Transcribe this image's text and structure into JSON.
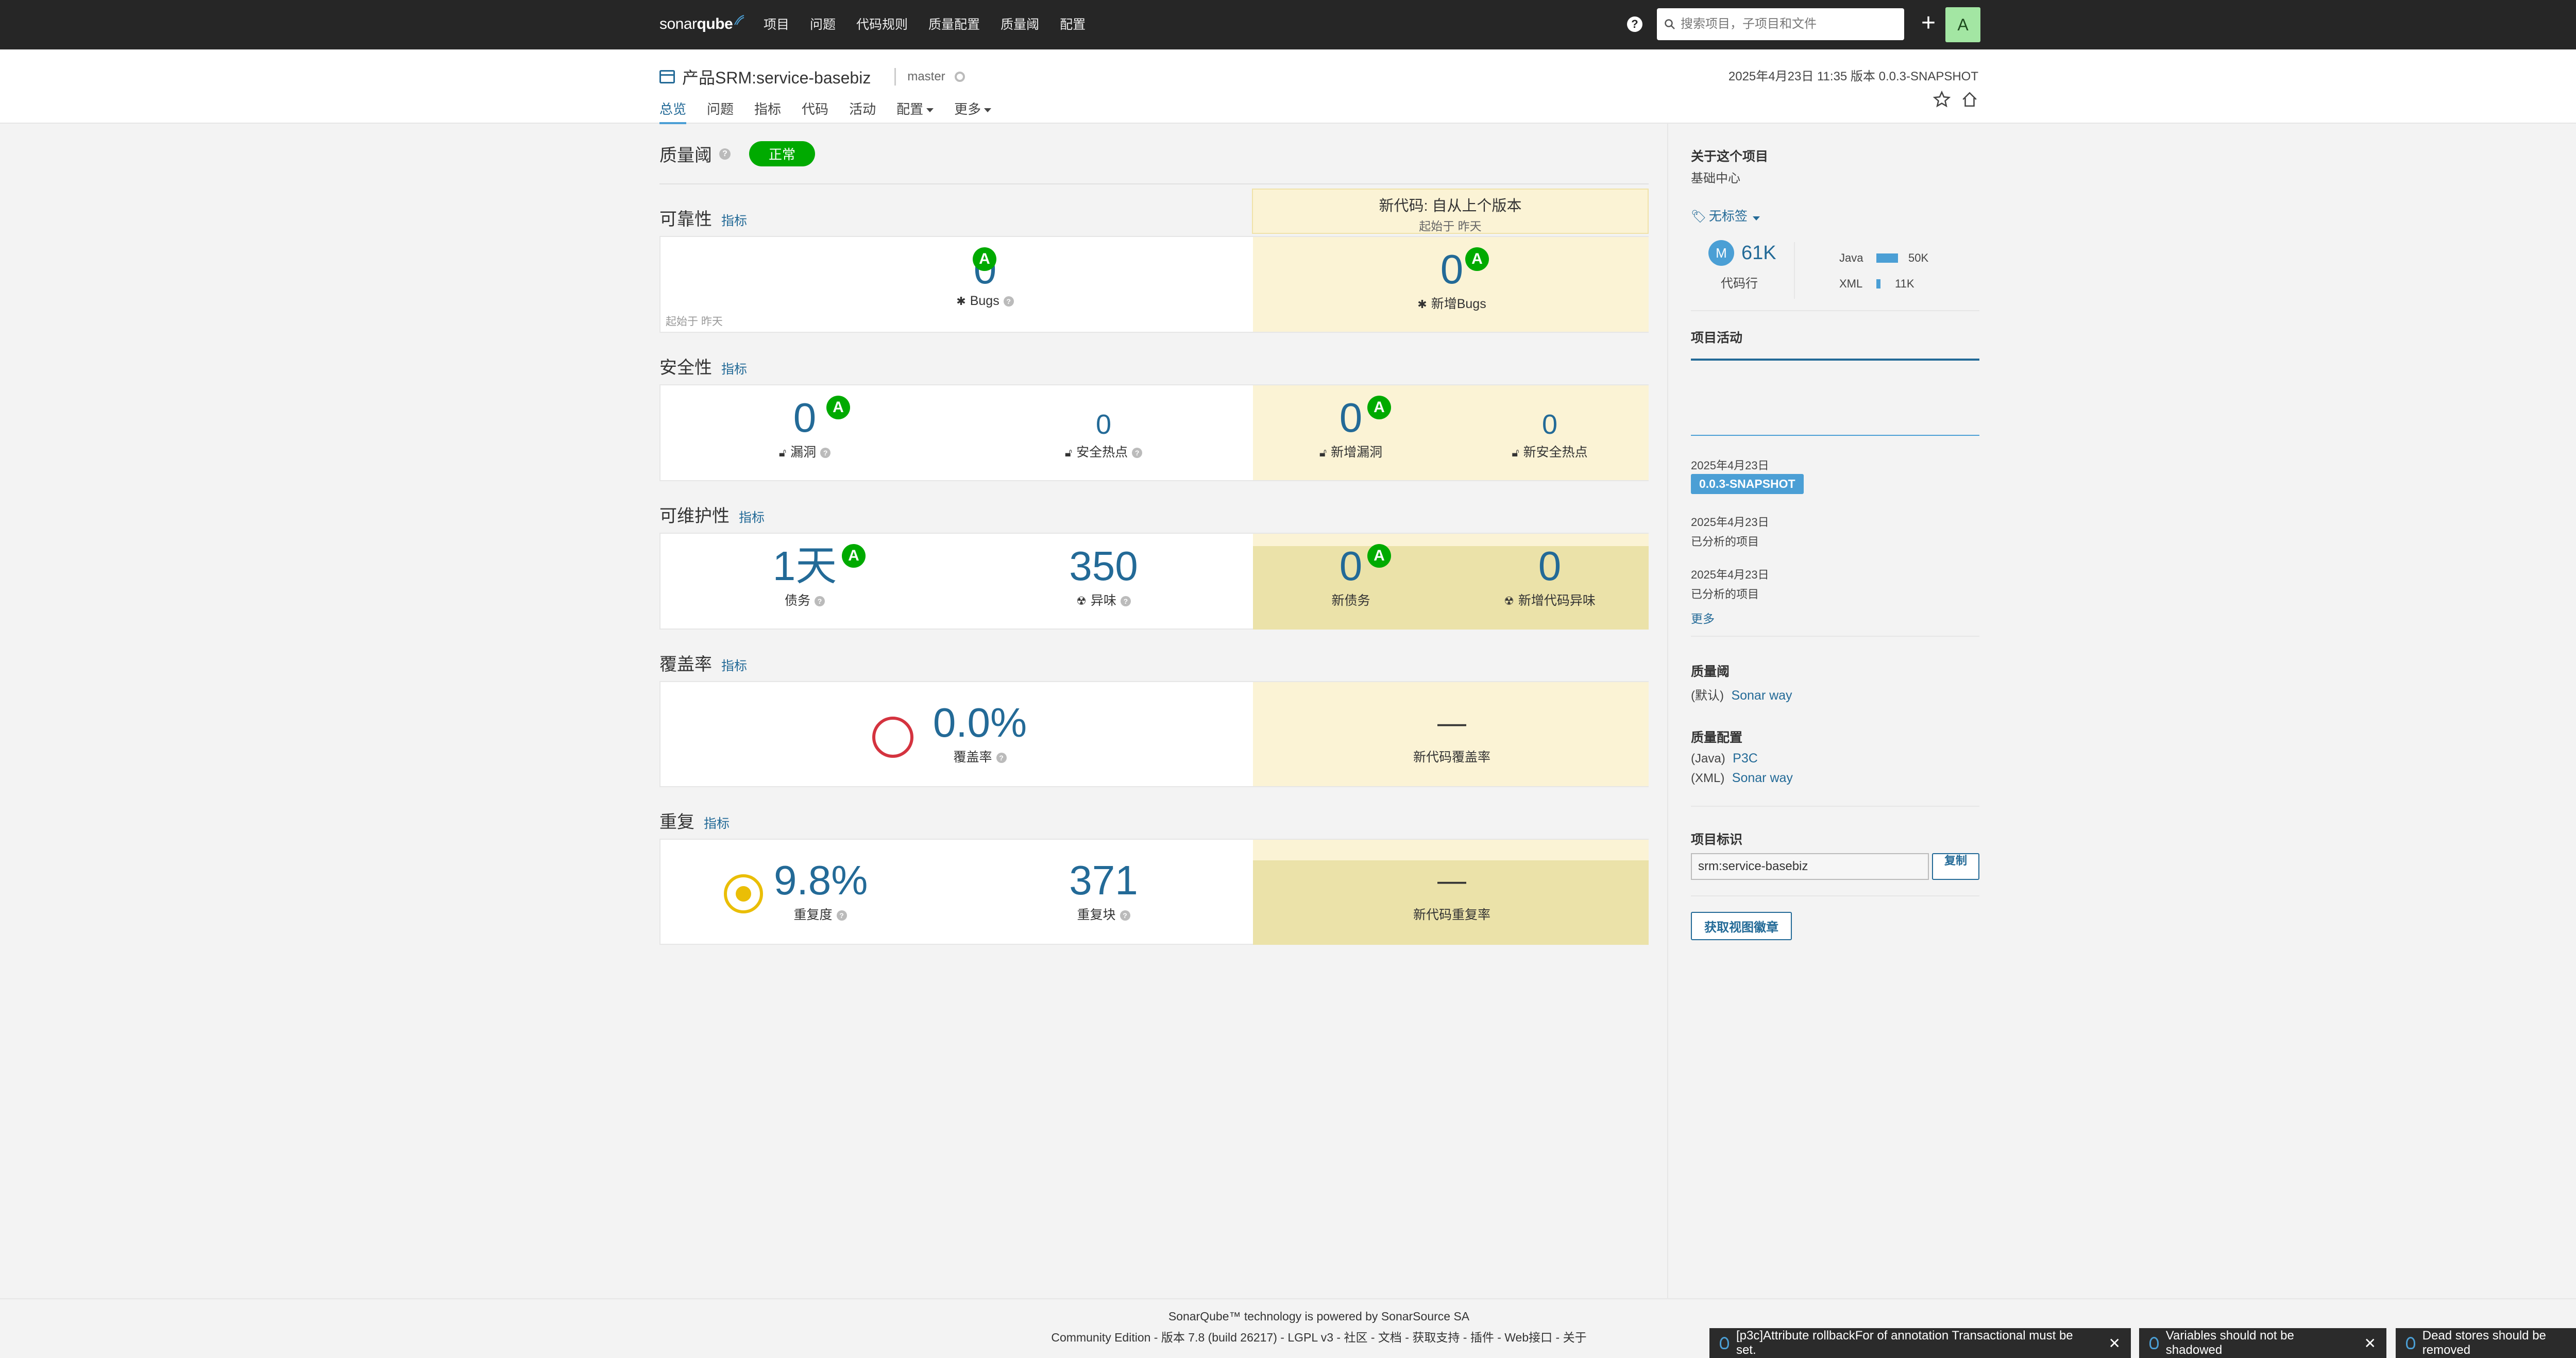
{
  "topnav": {
    "logo": {
      "part1": "sonar",
      "part2": "qube"
    },
    "menu": [
      "项目",
      "问题",
      "代码规则",
      "质量配置",
      "质量阈",
      "配置"
    ],
    "search_placeholder": "搜索项目，子项目和文件",
    "user_initial": "A"
  },
  "project": {
    "name": "产品SRM:service-basebiz",
    "branch": "master",
    "meta": "2025年4月23日 11:35  版本 0.0.3-SNAPSHOT",
    "tabs": [
      "总览",
      "问题",
      "指标",
      "代码",
      "活动",
      "配置",
      "更多"
    ]
  },
  "quality_gate": {
    "title": "质量阈",
    "status": "正常",
    "status_color": "#00aa00"
  },
  "new_code_header": {
    "line1": "新代码: 自从上个版本",
    "line2": "起始于 昨天"
  },
  "metric_link": "指标",
  "reliability": {
    "title": "可靠性",
    "since": "起始于 昨天",
    "bugs": {
      "value": "0",
      "rating": "A",
      "label": "Bugs"
    },
    "new_bugs": {
      "value": "0",
      "rating": "A",
      "label": "新增Bugs"
    }
  },
  "security": {
    "title": "安全性",
    "vulnerabilities": {
      "value": "0",
      "rating": "A",
      "label": "漏洞"
    },
    "hotspots": {
      "value": "0",
      "label": "安全热点"
    },
    "new_vulnerabilities": {
      "value": "0",
      "rating": "A",
      "label": "新增漏洞"
    },
    "new_hotspots": {
      "value": "0",
      "label": "新安全热点"
    }
  },
  "maintainability": {
    "title": "可维护性",
    "debt": {
      "value": "1天",
      "rating": "A",
      "label": "债务"
    },
    "smells": {
      "value": "350",
      "label": "异味"
    },
    "new_debt": {
      "value": "0",
      "rating": "A",
      "label": "新债务"
    },
    "new_smells": {
      "value": "0",
      "label": "新增代码异味"
    }
  },
  "coverage": {
    "title": "覆盖率",
    "coverage": {
      "value": "0.0%",
      "label": "覆盖率",
      "percent": 0
    },
    "new_coverage": {
      "value": "—",
      "label": "新代码覆盖率"
    }
  },
  "duplications": {
    "title": "重复",
    "density": {
      "value": "9.8%",
      "label": "重复度"
    },
    "blocks": {
      "value": "371",
      "label": "重复块"
    },
    "new_density": {
      "value": "—",
      "label": "新代码重复率"
    }
  },
  "sidebar": {
    "about_title": "关于这个项目",
    "description": "基础中心",
    "tags": "无标签",
    "loc": {
      "size_letter": "M",
      "value": "61K",
      "label": "代码行"
    },
    "languages": [
      {
        "name": "Java",
        "value": "50K",
        "fraction": 0.82
      },
      {
        "name": "XML",
        "value": "11K",
        "fraction": 0.18
      }
    ],
    "activity_title": "项目活动",
    "activity": [
      {
        "date": "2025年4月23日",
        "version": "0.0.3-SNAPSHOT"
      },
      {
        "date": "2025年4月23日",
        "text": "已分析的项目"
      },
      {
        "date": "2025年4月23日",
        "text": "已分析的项目"
      }
    ],
    "more": "更多",
    "quality_gate_title": "质量阈",
    "quality_gate": {
      "prefix": "(默认)",
      "name": "Sonar way"
    },
    "profiles_title": "质量配置",
    "profiles": [
      {
        "lang": "(Java)",
        "name": "P3C"
      },
      {
        "lang": "(XML)",
        "name": "Sonar way"
      }
    ],
    "key_title": "项目标识",
    "key": "srm:service-basebiz",
    "copy": "复制",
    "badge_button": "获取视图徽章"
  },
  "footer": {
    "line1_prefix": "SonarQube™ technology is powered by ",
    "line1_link": "SonarSource SA",
    "edition": "Community Edition",
    "version": "版本 7.8 (build 26217)",
    "links": [
      "LGPL v3",
      "社区",
      "文档",
      "获取支持",
      "插件",
      "Web接口",
      "关于"
    ]
  },
  "toasts": [
    "[p3c]Attribute rollbackFor of annotation Transactional must be set.",
    "Variables should not be shadowed",
    "Dead stores should be removed"
  ]
}
